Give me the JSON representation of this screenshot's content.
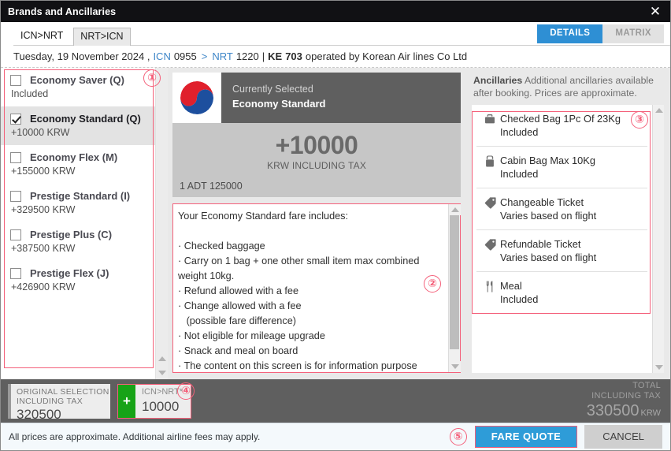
{
  "window": {
    "title": "Brands and Ancillaries",
    "close_icon": "close-icon",
    "close_glyph": "✕"
  },
  "tabs": {
    "items": [
      {
        "label": "ICN>NRT",
        "active": true
      },
      {
        "label": "NRT>ICN",
        "active": false
      }
    ],
    "view_toggle": [
      {
        "label": "DETAILS",
        "active": true
      },
      {
        "label": "MATRIX",
        "active": false
      }
    ]
  },
  "flight": {
    "date": "Tuesday, 19 November 2024 ,",
    "origin": "ICN",
    "dep_time": "0955",
    "arrow": ">",
    "destination": "NRT",
    "arr_time": "1220",
    "separator": "|",
    "carrier_code": "KE",
    "flight_number": "703",
    "operated_by": "operated by Korean Air lines Co Ltd"
  },
  "brands": {
    "items": [
      {
        "name": "Economy Saver (Q)",
        "price": "Included",
        "checked": false,
        "selected": false
      },
      {
        "name": "Economy Standard (Q)",
        "price": "+10000  KRW",
        "checked": true,
        "selected": true
      },
      {
        "name": "Economy Flex (M)",
        "price": "+155000  KRW",
        "checked": false,
        "selected": false
      },
      {
        "name": "Prestige Standard (I)",
        "price": "+329500  KRW",
        "checked": false,
        "selected": false
      },
      {
        "name": "Prestige Plus (C)",
        "price": "+387500  KRW",
        "checked": false,
        "selected": false
      },
      {
        "name": "Prestige Flex (J)",
        "price": "+426900  KRW",
        "checked": false,
        "selected": false
      }
    ]
  },
  "selection": {
    "logo_icon": "korean-air-logo",
    "header_label": "Currently Selected",
    "header_value": "Economy Standard",
    "price": "+10000",
    "price_sub": "KRW INCLUDING TAX",
    "pax": "1 ADT 125000"
  },
  "fare_details": {
    "heading": "Your Economy Standard fare includes:",
    "body": "\n\n· Checked baggage\n· Carry on 1 bag + one other small item max combined\nweight 10kg.\n· Refund allowed with a fee\n· Change allowed with a fee\n   (possible fare difference)\n· Not eligible for mileage upgrade\n· Snack and meal on board\n· The content on this screen is for information purpose"
  },
  "ancillaries": {
    "header_bold": "Ancillaries",
    "header_text": " Additional ancillaries available after booking. Prices are approximate.",
    "items": [
      {
        "icon": "checked-bag-icon",
        "title": "Checked Bag 1Pc Of 23Kg",
        "sub": "Included"
      },
      {
        "icon": "cabin-bag-icon",
        "title": "Cabin Bag Max 10Kg",
        "sub": "Included"
      },
      {
        "icon": "tag-icon",
        "title": "Changeable Ticket",
        "sub": "Varies based on flight"
      },
      {
        "icon": "tag-icon",
        "title": "Refundable Ticket",
        "sub": "Varies based on flight"
      },
      {
        "icon": "meal-icon",
        "title": "Meal",
        "sub": "Included"
      }
    ]
  },
  "totals": {
    "original_line1": "ORIGINAL SELECTION",
    "original_line2": "INCLUDING TAX",
    "original_amount": "320500",
    "add_plus": "+",
    "add_segment": "ICN>NRT*",
    "add_amount": "10000",
    "total_line1": "TOTAL",
    "total_line2": "INCLUDING TAX",
    "total_amount": "330500",
    "total_currency": "KRW"
  },
  "footer": {
    "note": "All prices are approximate. Additional airline fees may apply.",
    "primary_button": "FARE QUOTE",
    "cancel_button": "CANCEL"
  },
  "annotations": {
    "b1": "①",
    "b2": "②",
    "b3": "③",
    "b4": "④",
    "b5": "⑤"
  },
  "colors": {
    "accent_blue": "#2e9cd8",
    "tab_active_blue": "#2e8fd4",
    "annotation_red": "#f4607a",
    "plus_green": "#17a317",
    "dark_gray_bar": "#5f5f5f"
  }
}
